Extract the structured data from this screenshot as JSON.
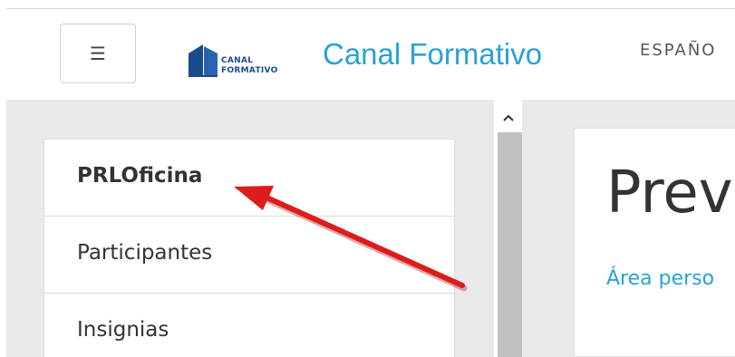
{
  "header": {
    "menu_icon": "hamburger-icon",
    "menu_glyph": "☰",
    "logo_line1": "CANAL",
    "logo_line2": "FORMATIVO",
    "brand": "Canal Formativo",
    "language": "ESPAÑO"
  },
  "sidebar": {
    "items": [
      {
        "label": "PRLOficina",
        "active": true
      },
      {
        "label": "Participantes",
        "active": false
      },
      {
        "label": "Insignias",
        "active": false
      }
    ]
  },
  "scrollbar": {
    "up_icon": "chevron-up-icon"
  },
  "main": {
    "title": "Prev",
    "breadcrumb": "Área perso"
  },
  "annotation": {
    "icon": "red-arrow-icon",
    "color": "#dd1c1c"
  },
  "colors": {
    "accent": "#2aa1d5",
    "logo": "#1b4b8a",
    "page_bg": "#e8e9ea"
  }
}
